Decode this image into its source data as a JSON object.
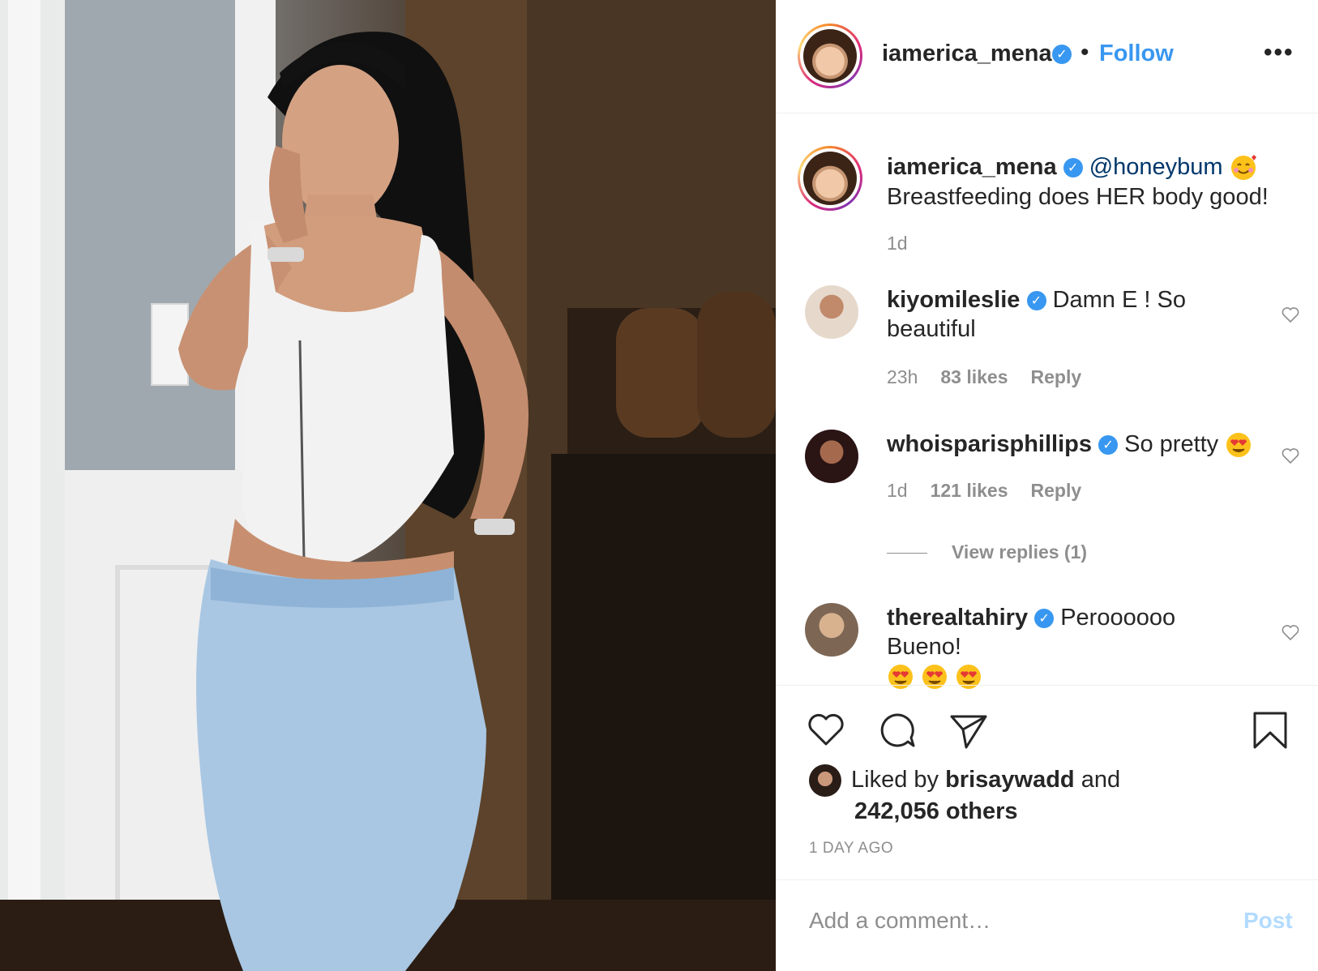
{
  "post": {
    "username": "iamerica_mena",
    "follow_label": "Follow",
    "separator": "•",
    "more_icon": "•••"
  },
  "caption": {
    "username": "iamerica_mena",
    "mention": "@honeybum",
    "emoji": "smiling-face-with-hearts",
    "text": "Breastfeeding does HER body good!",
    "time": "1d"
  },
  "comments": [
    {
      "username": "kiyomileslie",
      "text": "Damn E ! So beautiful",
      "time": "23h",
      "likes": "83 likes",
      "reply": "Reply"
    },
    {
      "username": "whoisparisphillips",
      "text": "So pretty",
      "emoji": "heart-eyes",
      "time": "1d",
      "likes": "121 likes",
      "reply": "Reply"
    },
    {
      "username": "therealtahiry",
      "text": "Peroooooo Bueno!",
      "emoji_count": 3,
      "emoji": "heart-eyes"
    }
  ],
  "view_replies": "View replies (1)",
  "likes": {
    "prefix": "Liked by",
    "user": "brisaywadd",
    "and": "and",
    "others": "242,056 others"
  },
  "timestamp": "1 DAY AGO",
  "add_comment": {
    "placeholder": "Add a comment…",
    "post_label": "Post"
  },
  "colors": {
    "accent": "#3897f0",
    "text": "#262626",
    "muted": "#8e8e8e",
    "mention": "#00376b",
    "post_disabled": "#b3dbff"
  }
}
